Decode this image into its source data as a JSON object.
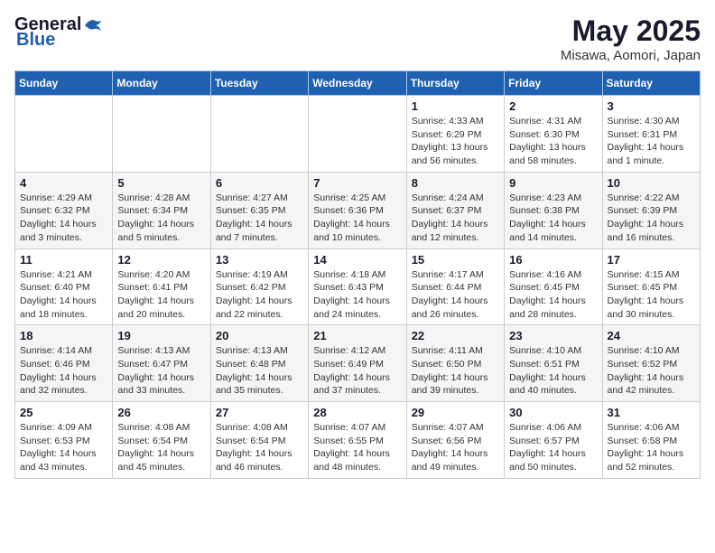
{
  "header": {
    "logo_general": "General",
    "logo_blue": "Blue",
    "month_title": "May 2025",
    "location": "Misawa, Aomori, Japan"
  },
  "days_of_week": [
    "Sunday",
    "Monday",
    "Tuesday",
    "Wednesday",
    "Thursday",
    "Friday",
    "Saturday"
  ],
  "weeks": [
    [
      {
        "day": "",
        "info": ""
      },
      {
        "day": "",
        "info": ""
      },
      {
        "day": "",
        "info": ""
      },
      {
        "day": "",
        "info": ""
      },
      {
        "day": "1",
        "info": "Sunrise: 4:33 AM\nSunset: 6:29 PM\nDaylight: 13 hours\nand 56 minutes."
      },
      {
        "day": "2",
        "info": "Sunrise: 4:31 AM\nSunset: 6:30 PM\nDaylight: 13 hours\nand 58 minutes."
      },
      {
        "day": "3",
        "info": "Sunrise: 4:30 AM\nSunset: 6:31 PM\nDaylight: 14 hours\nand 1 minute."
      }
    ],
    [
      {
        "day": "4",
        "info": "Sunrise: 4:29 AM\nSunset: 6:32 PM\nDaylight: 14 hours\nand 3 minutes."
      },
      {
        "day": "5",
        "info": "Sunrise: 4:28 AM\nSunset: 6:34 PM\nDaylight: 14 hours\nand 5 minutes."
      },
      {
        "day": "6",
        "info": "Sunrise: 4:27 AM\nSunset: 6:35 PM\nDaylight: 14 hours\nand 7 minutes."
      },
      {
        "day": "7",
        "info": "Sunrise: 4:25 AM\nSunset: 6:36 PM\nDaylight: 14 hours\nand 10 minutes."
      },
      {
        "day": "8",
        "info": "Sunrise: 4:24 AM\nSunset: 6:37 PM\nDaylight: 14 hours\nand 12 minutes."
      },
      {
        "day": "9",
        "info": "Sunrise: 4:23 AM\nSunset: 6:38 PM\nDaylight: 14 hours\nand 14 minutes."
      },
      {
        "day": "10",
        "info": "Sunrise: 4:22 AM\nSunset: 6:39 PM\nDaylight: 14 hours\nand 16 minutes."
      }
    ],
    [
      {
        "day": "11",
        "info": "Sunrise: 4:21 AM\nSunset: 6:40 PM\nDaylight: 14 hours\nand 18 minutes."
      },
      {
        "day": "12",
        "info": "Sunrise: 4:20 AM\nSunset: 6:41 PM\nDaylight: 14 hours\nand 20 minutes."
      },
      {
        "day": "13",
        "info": "Sunrise: 4:19 AM\nSunset: 6:42 PM\nDaylight: 14 hours\nand 22 minutes."
      },
      {
        "day": "14",
        "info": "Sunrise: 4:18 AM\nSunset: 6:43 PM\nDaylight: 14 hours\nand 24 minutes."
      },
      {
        "day": "15",
        "info": "Sunrise: 4:17 AM\nSunset: 6:44 PM\nDaylight: 14 hours\nand 26 minutes."
      },
      {
        "day": "16",
        "info": "Sunrise: 4:16 AM\nSunset: 6:45 PM\nDaylight: 14 hours\nand 28 minutes."
      },
      {
        "day": "17",
        "info": "Sunrise: 4:15 AM\nSunset: 6:45 PM\nDaylight: 14 hours\nand 30 minutes."
      }
    ],
    [
      {
        "day": "18",
        "info": "Sunrise: 4:14 AM\nSunset: 6:46 PM\nDaylight: 14 hours\nand 32 minutes."
      },
      {
        "day": "19",
        "info": "Sunrise: 4:13 AM\nSunset: 6:47 PM\nDaylight: 14 hours\nand 33 minutes."
      },
      {
        "day": "20",
        "info": "Sunrise: 4:13 AM\nSunset: 6:48 PM\nDaylight: 14 hours\nand 35 minutes."
      },
      {
        "day": "21",
        "info": "Sunrise: 4:12 AM\nSunset: 6:49 PM\nDaylight: 14 hours\nand 37 minutes."
      },
      {
        "day": "22",
        "info": "Sunrise: 4:11 AM\nSunset: 6:50 PM\nDaylight: 14 hours\nand 39 minutes."
      },
      {
        "day": "23",
        "info": "Sunrise: 4:10 AM\nSunset: 6:51 PM\nDaylight: 14 hours\nand 40 minutes."
      },
      {
        "day": "24",
        "info": "Sunrise: 4:10 AM\nSunset: 6:52 PM\nDaylight: 14 hours\nand 42 minutes."
      }
    ],
    [
      {
        "day": "25",
        "info": "Sunrise: 4:09 AM\nSunset: 6:53 PM\nDaylight: 14 hours\nand 43 minutes."
      },
      {
        "day": "26",
        "info": "Sunrise: 4:08 AM\nSunset: 6:54 PM\nDaylight: 14 hours\nand 45 minutes."
      },
      {
        "day": "27",
        "info": "Sunrise: 4:08 AM\nSunset: 6:54 PM\nDaylight: 14 hours\nand 46 minutes."
      },
      {
        "day": "28",
        "info": "Sunrise: 4:07 AM\nSunset: 6:55 PM\nDaylight: 14 hours\nand 48 minutes."
      },
      {
        "day": "29",
        "info": "Sunrise: 4:07 AM\nSunset: 6:56 PM\nDaylight: 14 hours\nand 49 minutes."
      },
      {
        "day": "30",
        "info": "Sunrise: 4:06 AM\nSunset: 6:57 PM\nDaylight: 14 hours\nand 50 minutes."
      },
      {
        "day": "31",
        "info": "Sunrise: 4:06 AM\nSunset: 6:58 PM\nDaylight: 14 hours\nand 52 minutes."
      }
    ]
  ]
}
